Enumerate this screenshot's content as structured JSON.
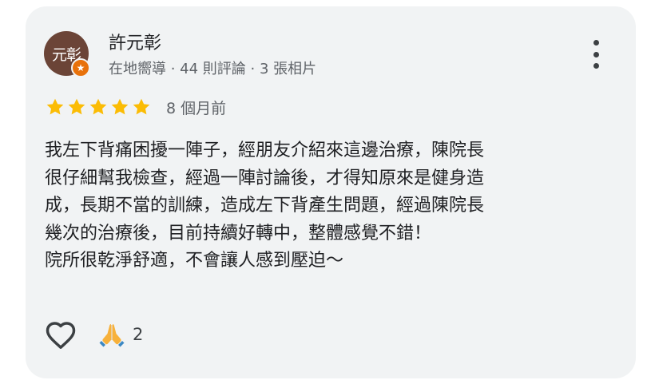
{
  "reviewer": {
    "avatar_text": "元彰",
    "badge_symbol": "★",
    "name": "許元彰",
    "meta": "在地嚮導 · 44 則評論 · 3 張相片"
  },
  "rating": {
    "stars": 5,
    "max": 5,
    "date": "8 個月前"
  },
  "review": {
    "text": "我左下背痛困擾一陣子，經朋友介紹來這邊治療，陳院長\n很仔細幫我檢查，經過一陣討論後，才得知原來是健身造\n成，長期不當的訓練，造成左下背產生問題，經過陳院長\n幾次的治療後，目前持續好轉中，整體感覺不錯！\n院所很乾淨舒適，不會讓人感到壓迫～"
  },
  "actions": {
    "like_icon": "heart-outline-icon",
    "reaction_icon": "folded-hands-icon",
    "reaction_count": "2"
  },
  "colors": {
    "card_bg": "#f1f3f4",
    "avatar_bg": "#6b4437",
    "badge_bg": "#e8710a",
    "star": "#fbbc04",
    "text": "#202124",
    "muted": "#5f6368"
  }
}
